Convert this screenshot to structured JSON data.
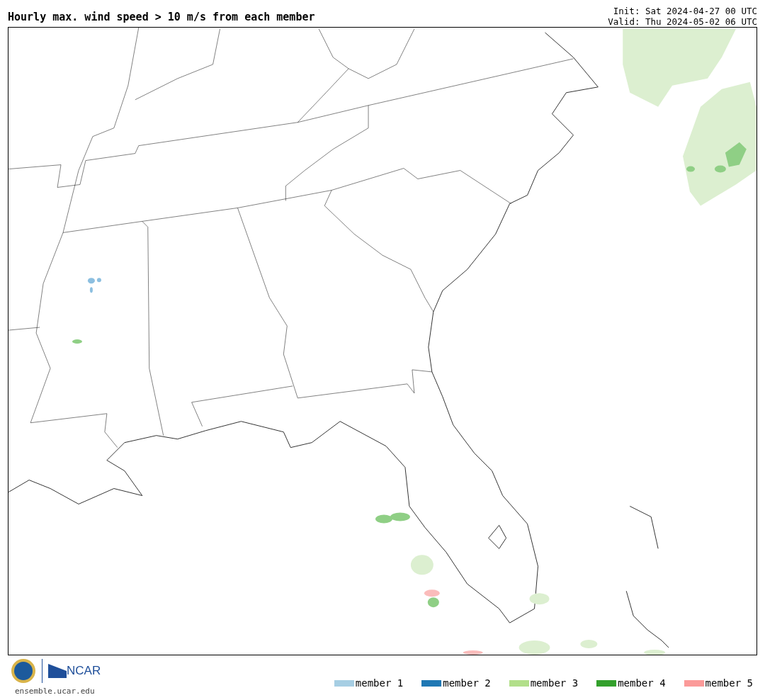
{
  "title": "Hourly max. wind speed > 10 m/s from each member",
  "init": "Init: Sat 2024-04-27 00 UTC",
  "valid": "Valid: Thu 2024-05-02 06 UTC",
  "site": "ensemble.ucar.edu",
  "logo_text": "NCAR",
  "legend": [
    {
      "label": "member 1",
      "color": "#a6cee3"
    },
    {
      "label": "member 2",
      "color": "#1f78b4"
    },
    {
      "label": "member 3",
      "color": "#b2df8a"
    },
    {
      "label": "member 4",
      "color": "#33a02c"
    },
    {
      "label": "member 5",
      "color": "#fb9a99"
    }
  ]
}
